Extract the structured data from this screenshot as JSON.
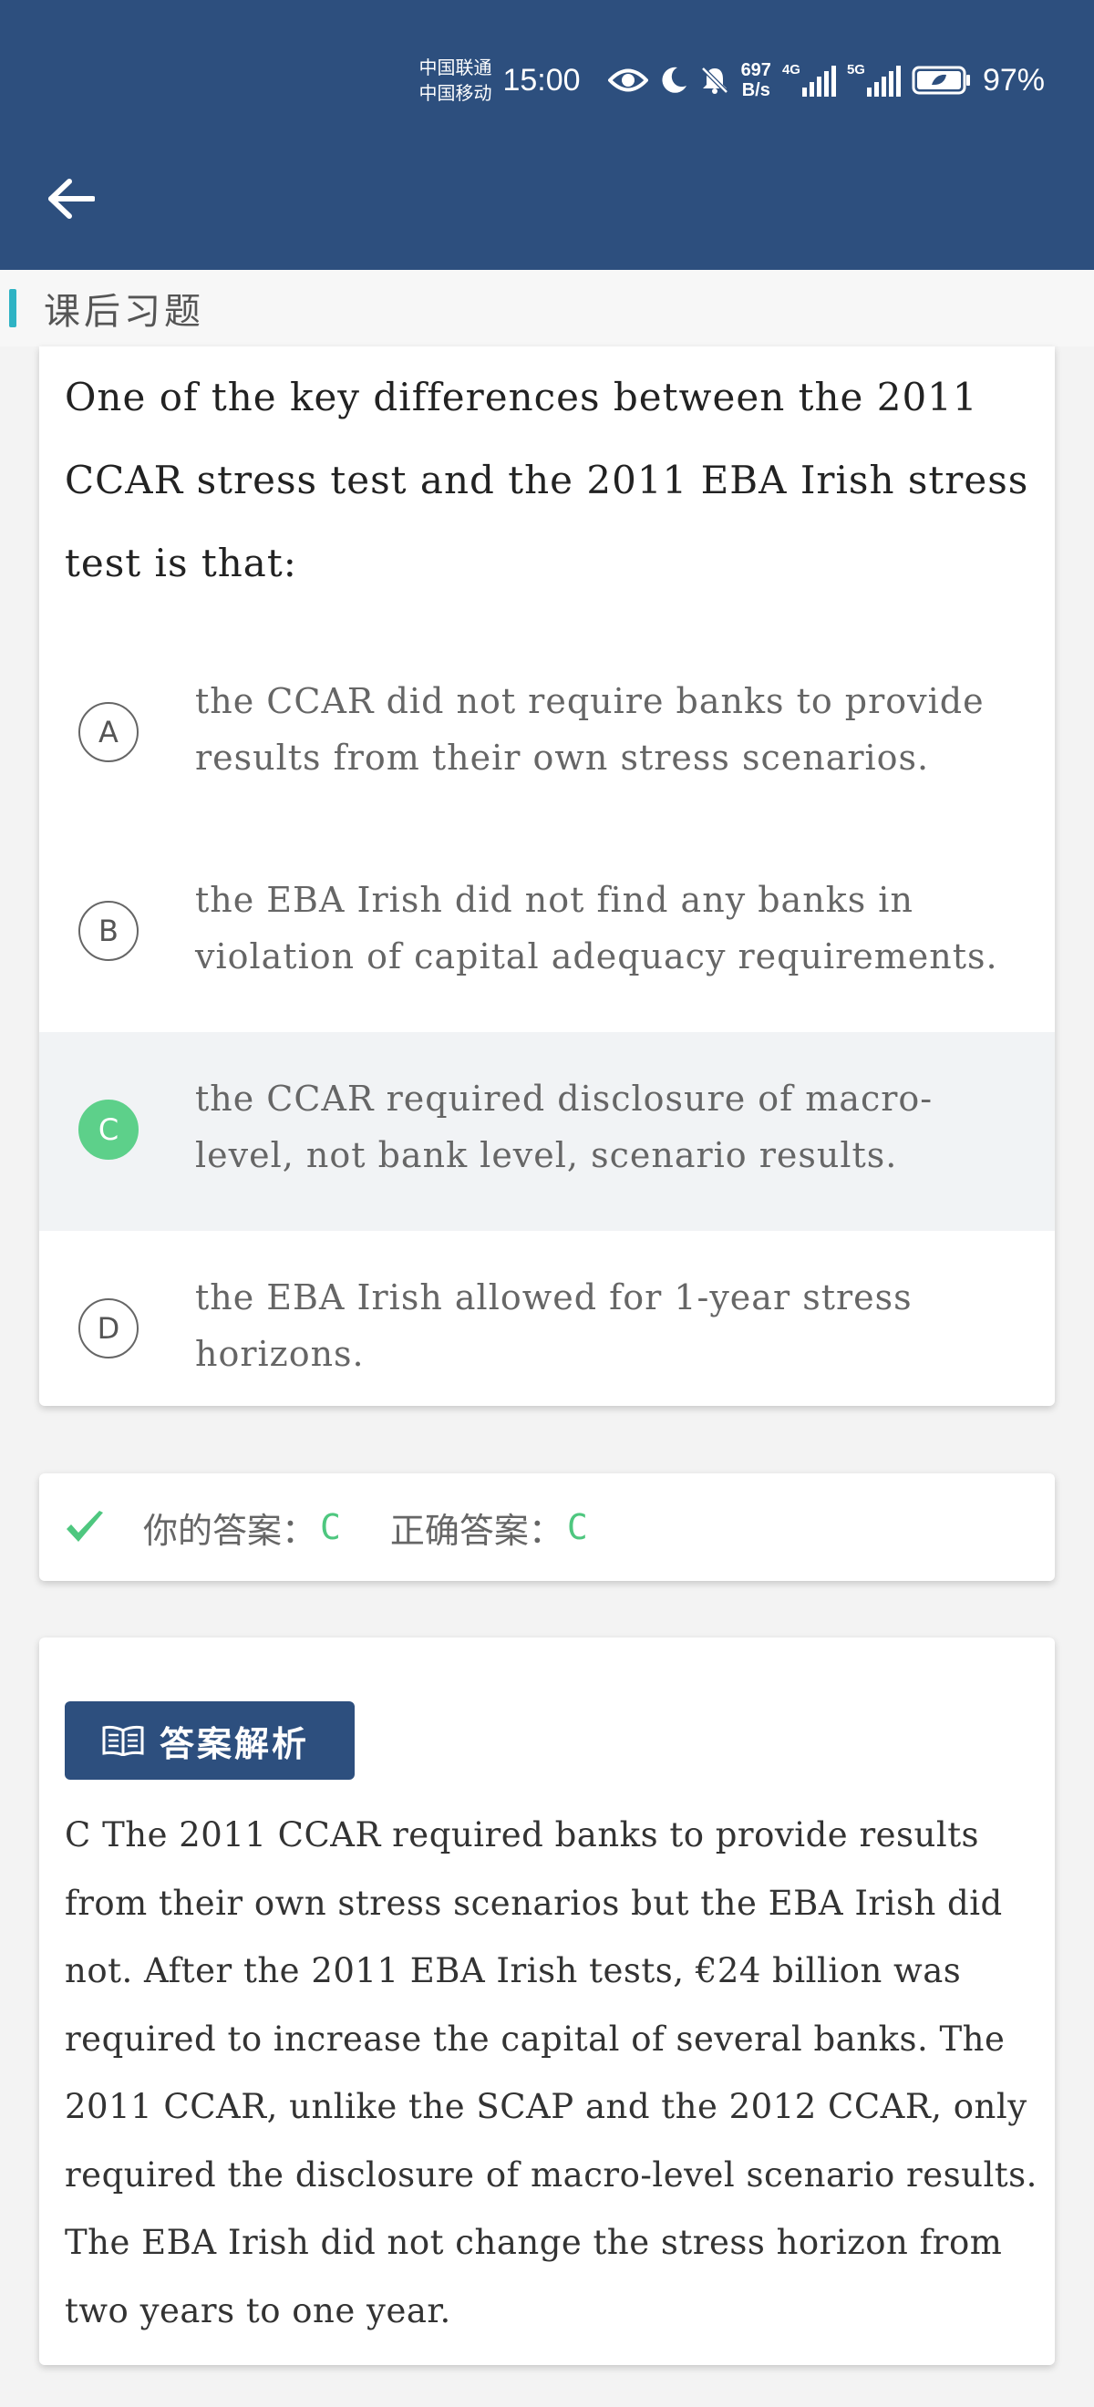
{
  "status_bar": {
    "carrier_1": "中国联通",
    "carrier_2": "中国移动",
    "time": "15:00",
    "net_speed_value": "697",
    "net_speed_unit": "B/s",
    "signal_1_tag": "4G",
    "signal_2_tag": "5G",
    "battery_percent": "97%"
  },
  "header": {
    "back_icon": "arrow-left-icon"
  },
  "section": {
    "title": "课后习题"
  },
  "question": {
    "text": "One of the key differences between the 2011 CCAR stress test and the 2011 EBA Irish stress test is that:",
    "options": [
      {
        "letter": "A",
        "text": "the CCAR did not require banks to provide results from their own stress scenarios."
      },
      {
        "letter": "B",
        "text": "the EBA Irish did not find any banks in violation of capital adequacy requirements."
      },
      {
        "letter": "C",
        "text": "the CCAR required disclosure of macro-level, not bank level, scenario results."
      },
      {
        "letter": "D",
        "text": "the EBA Irish allowed for 1-year stress horizons."
      }
    ],
    "selected": "C"
  },
  "result": {
    "your_answer_label": "你的答案：",
    "your_answer": "C",
    "correct_answer_label": "正确答案：",
    "correct_answer": "C",
    "status_icon": "checkmark-icon"
  },
  "explanation": {
    "button_label": "答案解析",
    "button_icon": "book-icon",
    "text": "C The 2011 CCAR required banks to provide results from their own stress scenarios but the EBA Irish did not. After the 2011 EBA Irish tests, €24 billion was required to increase the capital of several banks. The 2011 CCAR, unlike the SCAP and the 2012 CCAR, only required the disclosure of macro-level scenario results. The EBA Irish did not change the stress horizon from two years to one year."
  },
  "colors": {
    "header": "#2d4f7e",
    "accent": "#2fb3c4",
    "correct": "#5dd08a"
  }
}
